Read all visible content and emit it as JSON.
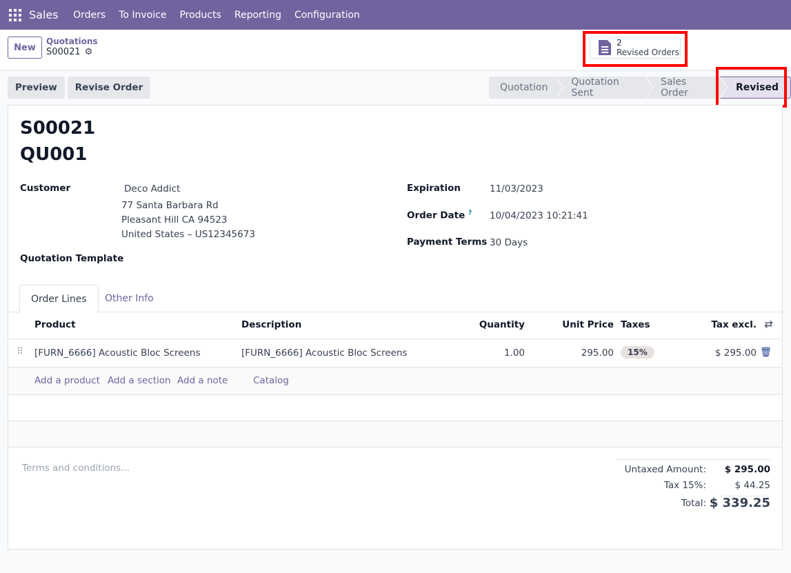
{
  "nav": {
    "app": "Sales",
    "menu": [
      "Orders",
      "To Invoice",
      "Products",
      "Reporting",
      "Configuration"
    ]
  },
  "control": {
    "new_label": "New",
    "breadcrumb_parent": "Quotations",
    "breadcrumb_current": "S00021",
    "smart_button": {
      "count": "2",
      "label": "Revised Orders",
      "icon": "document-icon"
    }
  },
  "actions": {
    "preview": "Preview",
    "revise": "Revise Order"
  },
  "statusbar": {
    "stages": [
      "Quotation",
      "Quotation Sent",
      "Sales Order",
      "Revised"
    ],
    "active": "Revised"
  },
  "form": {
    "name": "S00021",
    "revision": "QU001",
    "customer_label": "Customer",
    "customer_name": "Deco Addict",
    "address": [
      "77 Santa Barbara Rd",
      "Pleasant Hill CA 94523",
      "United States – US12345673"
    ],
    "template_label": "Quotation Template",
    "expiration_label": "Expiration",
    "expiration": "11/03/2023",
    "order_date_label": "Order Date",
    "order_date_help": "?",
    "order_date": "10/04/2023 10:21:41",
    "payment_terms_label": "Payment Terms",
    "payment_terms": "30 Days"
  },
  "tabs": [
    "Order Lines",
    "Other Info"
  ],
  "lines": {
    "headers": [
      "Product",
      "Description",
      "Quantity",
      "Unit Price",
      "Taxes",
      "Tax excl."
    ],
    "rows": [
      {
        "product": "[FURN_6666] Acoustic Bloc Screens",
        "description": "[FURN_6666] Acoustic Bloc Screens",
        "quantity": "1.00",
        "unit_price": "295.00",
        "taxes": "15%",
        "subtotal": "$ 295.00"
      }
    ],
    "add_links": [
      "Add a product",
      "Add a section",
      "Add a note",
      "Catalog"
    ]
  },
  "terms_placeholder": "Terms and conditions...",
  "totals": {
    "untaxed_label": "Untaxed Amount:",
    "untaxed": "$ 295.00",
    "tax_label": "Tax 15%:",
    "tax": "$ 44.25",
    "total_label": "Total:",
    "total": "$ 339.25"
  },
  "colors": {
    "brand": "#71639e",
    "highlight": "#ff0000"
  }
}
